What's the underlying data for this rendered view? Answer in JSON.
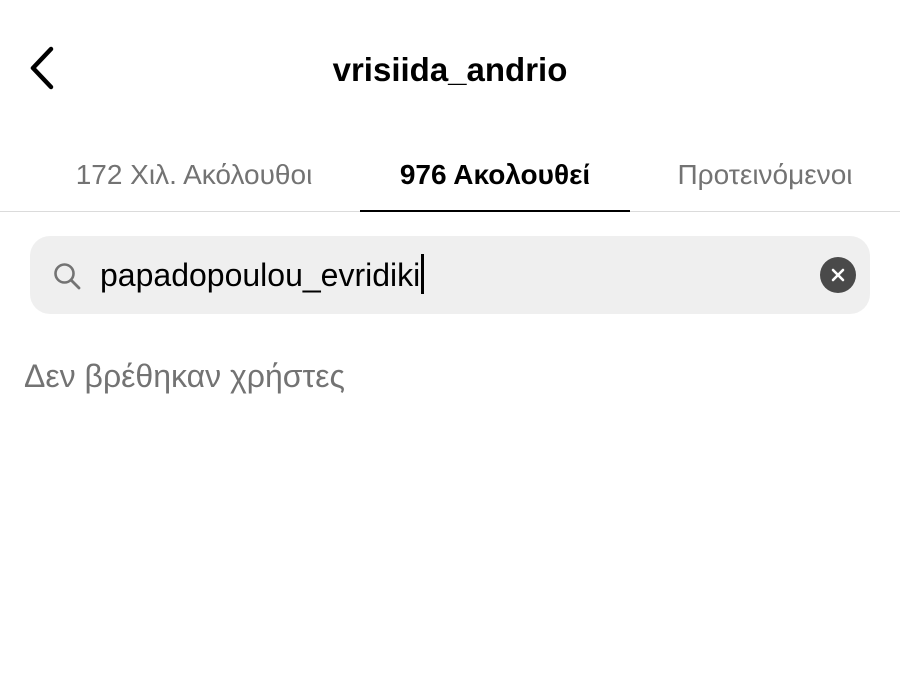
{
  "header": {
    "title": "vrisiida_andrio",
    "back_icon": "chevron-left-icon"
  },
  "tabs": [
    {
      "label": "172 Χιλ. Ακόλουθοι",
      "active": false
    },
    {
      "label": "976 Ακολουθεί",
      "active": true
    },
    {
      "label": "Προτεινόμενοι",
      "active": false
    }
  ],
  "search": {
    "icon": "search-icon",
    "value": "papadopoulou_evridiki",
    "clear_icon": "clear-icon"
  },
  "results": {
    "empty_message": "Δεν βρέθηκαν χρήστες"
  },
  "colors": {
    "primary_text": "#000000",
    "secondary_text": "#737373",
    "search_background": "#efefef",
    "divider": "#dbdbdb"
  }
}
